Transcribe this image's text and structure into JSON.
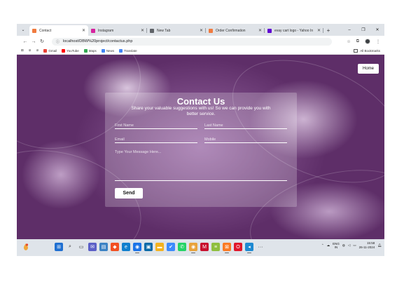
{
  "browser": {
    "tabs": [
      {
        "title": "Contact",
        "favicon_color": "#f07b3f",
        "active": true
      },
      {
        "title": "Instagram",
        "favicon_color": "#d6249f",
        "active": false
      },
      {
        "title": "New Tab",
        "favicon_color": "#5f6368",
        "active": false
      },
      {
        "title": "Order Confirmation",
        "favicon_color": "#f07b3f",
        "active": false
      },
      {
        "title": "evay cart logo - Yahoo In",
        "favicon_color": "#6001d2",
        "active": false
      }
    ],
    "new_tab_symbol": "+",
    "window_controls": {
      "minimize": "–",
      "restore": "❐",
      "close": "✕"
    },
    "address": "localhost/DBW%20project/contactus.php",
    "bookmarks": [
      {
        "label": "Gmail",
        "icon": "gmail-icon",
        "color": "#ea4335"
      },
      {
        "label": "YouTube",
        "icon": "youtube-icon",
        "color": "#ff0000"
      },
      {
        "label": "Maps",
        "icon": "maps-icon",
        "color": "#34a853"
      },
      {
        "label": "News",
        "icon": "news-icon",
        "color": "#4285f4"
      },
      {
        "label": "Translate",
        "icon": "translate-icon",
        "color": "#4285f4"
      }
    ],
    "all_bookmarks_label": "All Bookmarks"
  },
  "page": {
    "home_label": "Home",
    "contact": {
      "title": "Contact Us",
      "subtitle": "Share your valuable suggestions with us! So we can provide you with better service.",
      "first_name_placeholder": "First Name",
      "last_name_placeholder": "Last Name",
      "email_placeholder": "Email",
      "mobile_placeholder": "Mobile",
      "message_placeholder": "Type Your Message Here...",
      "send_label": "Send"
    }
  },
  "taskbar": {
    "apps": [
      {
        "name": "start-icon",
        "color": "#1f6fd1",
        "glyph": "⊞",
        "indicator": false
      },
      {
        "name": "search-icon",
        "color": "#4b4b4b",
        "glyph": "⌕",
        "indicator": false
      },
      {
        "name": "task-view-icon",
        "color": "#202020",
        "glyph": "▭",
        "indicator": false
      },
      {
        "name": "chat-icon",
        "color": "#5b5fc7",
        "glyph": "✉",
        "indicator": false
      },
      {
        "name": "widgets-icon",
        "color": "#3b82c4",
        "glyph": "▤",
        "indicator": false
      },
      {
        "name": "store-icon",
        "color": "#f25022",
        "glyph": "◆",
        "indicator": false
      },
      {
        "name": "edge-icon",
        "color": "#0f7fce",
        "glyph": "e",
        "indicator": false
      },
      {
        "name": "chrome-icon",
        "color": "#1a73e8",
        "glyph": "◉",
        "indicator": true
      },
      {
        "name": "terminal-icon",
        "color": "#0b6aa8",
        "glyph": "▣",
        "indicator": false
      },
      {
        "name": "file-explorer-icon",
        "color": "#f3b21f",
        "glyph": "▬",
        "indicator": false
      },
      {
        "name": "todo-icon",
        "color": "#3d8bfd",
        "glyph": "✔",
        "indicator": false
      },
      {
        "name": "whatsapp-icon",
        "color": "#25d366",
        "glyph": "✆",
        "indicator": false
      },
      {
        "name": "chrome-dev-icon",
        "color": "#e8a33b",
        "glyph": "◉",
        "indicator": true
      },
      {
        "name": "mcafee-icon",
        "color": "#c8102e",
        "glyph": "M",
        "indicator": false
      },
      {
        "name": "notepad-icon",
        "color": "#8fbf3f",
        "glyph": "≡",
        "indicator": false
      },
      {
        "name": "xampp-icon",
        "color": "#fb7a24",
        "glyph": "⊠",
        "indicator": true
      },
      {
        "name": "opera-icon",
        "color": "#e0162b",
        "glyph": "O",
        "indicator": false
      },
      {
        "name": "vscode-icon",
        "color": "#1f8ad2",
        "glyph": "◂",
        "indicator": true
      },
      {
        "name": "more-apps-icon",
        "color": "#dfe4ea",
        "glyph": "···",
        "indicator": false
      }
    ],
    "language_top": "ENG",
    "language_bottom": "IN",
    "time": "15:58",
    "date": "26-11-2024"
  }
}
